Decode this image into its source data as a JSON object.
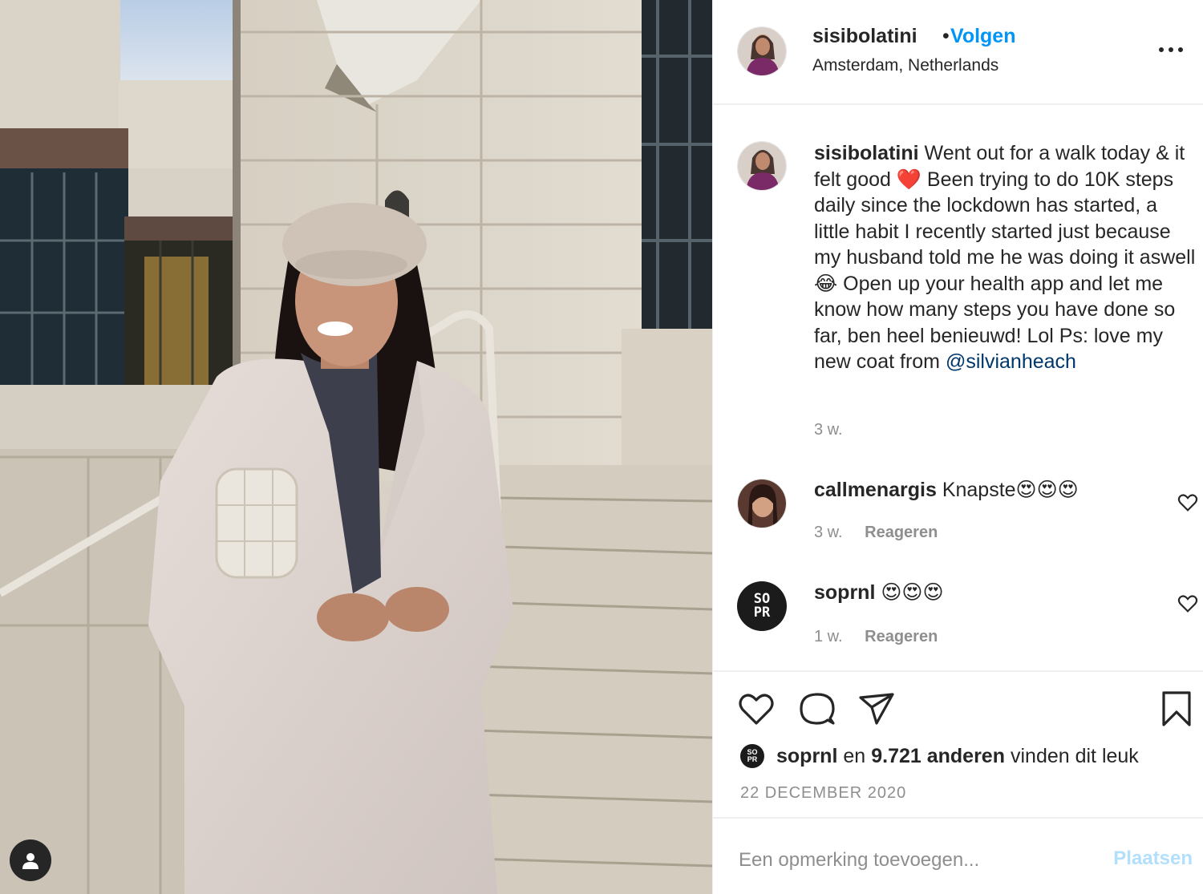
{
  "post": {
    "username": "sisibolatini",
    "separator": "•",
    "follow_label": "Volgen",
    "location": "Amsterdam, Netherlands"
  },
  "caption": {
    "username": "sisibolatini",
    "text_before_mention": "Went out for a walk today & it felt good ❤️ Been trying to do 10K steps daily since the lockdown has started, a little habit I recently started just because my husband told me he was doing it aswell😂 Open up your health app and let me know how many steps you have done so far, ben heel benieuwd! Lol Ps: love my new coat from",
    "mention": "@silvianheach",
    "time": "3 w."
  },
  "comments": [
    {
      "username": "callmenargis",
      "text": "Knapste😍😍😍",
      "time": "3 w.",
      "reply_label": "Reageren"
    },
    {
      "username": "soprnl",
      "text": "😍😍😍",
      "time": "1 w.",
      "reply_label": "Reageren"
    }
  ],
  "avatars": {
    "sopr_line1": "SO",
    "sopr_line2": "PR"
  },
  "likes": {
    "first_user": "soprnl",
    "connector": "en",
    "others": "9.721 anderen",
    "suffix": "vinden dit leuk"
  },
  "date": "22 DECEMBER 2020",
  "add_comment": {
    "placeholder": "Een opmerking toevoegen...",
    "post_label": "Plaatsen"
  },
  "colors": {
    "accent": "#0095f6",
    "post_button_disabled": "#b2dffc",
    "text": "#262626",
    "muted": "#8e8e8e"
  },
  "icons": [
    "user-tag-icon",
    "more-options-icon",
    "heart-icon",
    "comment-icon",
    "share-icon",
    "bookmark-icon"
  ]
}
